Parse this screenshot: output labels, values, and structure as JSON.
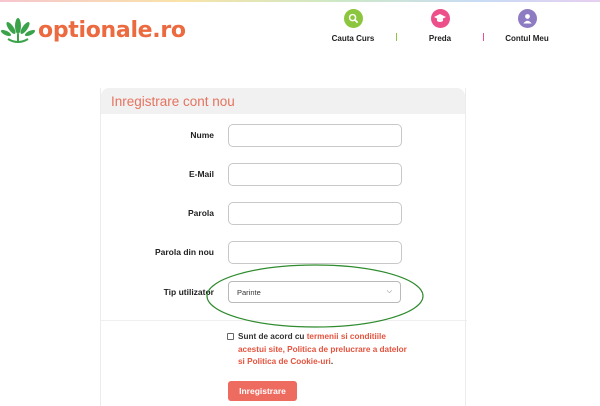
{
  "brand": {
    "name": "optionale.ro",
    "color": "#ec6a3f"
  },
  "nav": {
    "items": [
      {
        "label": "Cauta Curs",
        "icon": "search-icon",
        "color": "#8cc63f"
      },
      {
        "label": "Preda",
        "icon": "graduation-cap-icon",
        "color": "#ec4f8a"
      },
      {
        "label": "Contul Meu",
        "icon": "user-icon",
        "color": "#8e7cc3"
      }
    ],
    "separator_colors": [
      "#8cc63f",
      "#ec4f8a"
    ]
  },
  "form": {
    "title": "Inregistrare cont nou",
    "fields": [
      {
        "label": "Nume",
        "value": ""
      },
      {
        "label": "E-Mail",
        "value": ""
      },
      {
        "label": "Parola",
        "value": ""
      },
      {
        "label": "Parola din nou",
        "value": ""
      }
    ],
    "user_type": {
      "label": "Tip utilizator",
      "selected": "Parinte"
    },
    "terms": {
      "prefix": "Sunt de acord cu ",
      "link1": "termenii si conditiile acestui site, Politica de prelucrare a datelor si Politica de Cookie-uri",
      "suffix": "."
    },
    "submit": "Inregistrare"
  },
  "annotation": {
    "shape": "ellipse",
    "color": "#2e8b2e"
  }
}
